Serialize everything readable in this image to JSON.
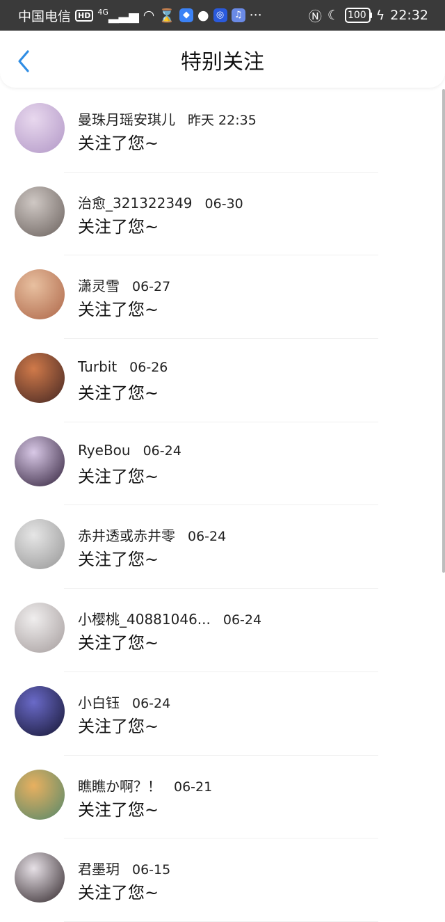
{
  "status_bar": {
    "carrier": "中国电信",
    "hd": "HD",
    "network": "4G",
    "battery": "100",
    "time": "22:32"
  },
  "header": {
    "title": "特别关注",
    "back_icon": "chevron-left-icon",
    "accent_color": "#2f8de4"
  },
  "items": [
    {
      "name": "曼珠月瑶安琪儿",
      "date": "昨天 22:35",
      "action": "关注了您~",
      "avatar_colors": [
        "#e8d8ee",
        "#b49ac8"
      ]
    },
    {
      "name": "治愈_321322349",
      "date": "06-30",
      "action": "关注了您~",
      "avatar_colors": [
        "#cfc8c4",
        "#6f6662"
      ]
    },
    {
      "name": "潇灵雪",
      "date": "06-27",
      "action": "关注了您~",
      "avatar_colors": [
        "#e8c0a0",
        "#b06a4c"
      ]
    },
    {
      "name": "Turbit",
      "date": "06-26",
      "action": "关注了您~",
      "avatar_colors": [
        "#d07a4a",
        "#4a2a24"
      ]
    },
    {
      "name": "RyeBou",
      "date": "06-24",
      "action": "关注了您~",
      "avatar_colors": [
        "#d8c8e6",
        "#3a2a44"
      ]
    },
    {
      "name": "赤井透或赤井零",
      "date": "06-24",
      "action": "关注了您~",
      "avatar_colors": [
        "#e6e6e6",
        "#9a9a9a"
      ]
    },
    {
      "name": "小樱桃_40881046...",
      "date": "06-24",
      "action": "关注了您~",
      "avatar_colors": [
        "#f0eeee",
        "#a8a0a0"
      ]
    },
    {
      "name": "小白钰",
      "date": "06-24",
      "action": "关注了您~",
      "avatar_colors": [
        "#6a6ac8",
        "#1a1a3a"
      ]
    },
    {
      "name": "瞧瞧か啊？！",
      "date": "06-21",
      "action": "关注了您~",
      "avatar_colors": [
        "#e8b060",
        "#5a8a6a"
      ]
    },
    {
      "name": "君墨玥",
      "date": "06-15",
      "action": "关注了您~",
      "avatar_colors": [
        "#e6e0e6",
        "#3a3034"
      ]
    }
  ]
}
